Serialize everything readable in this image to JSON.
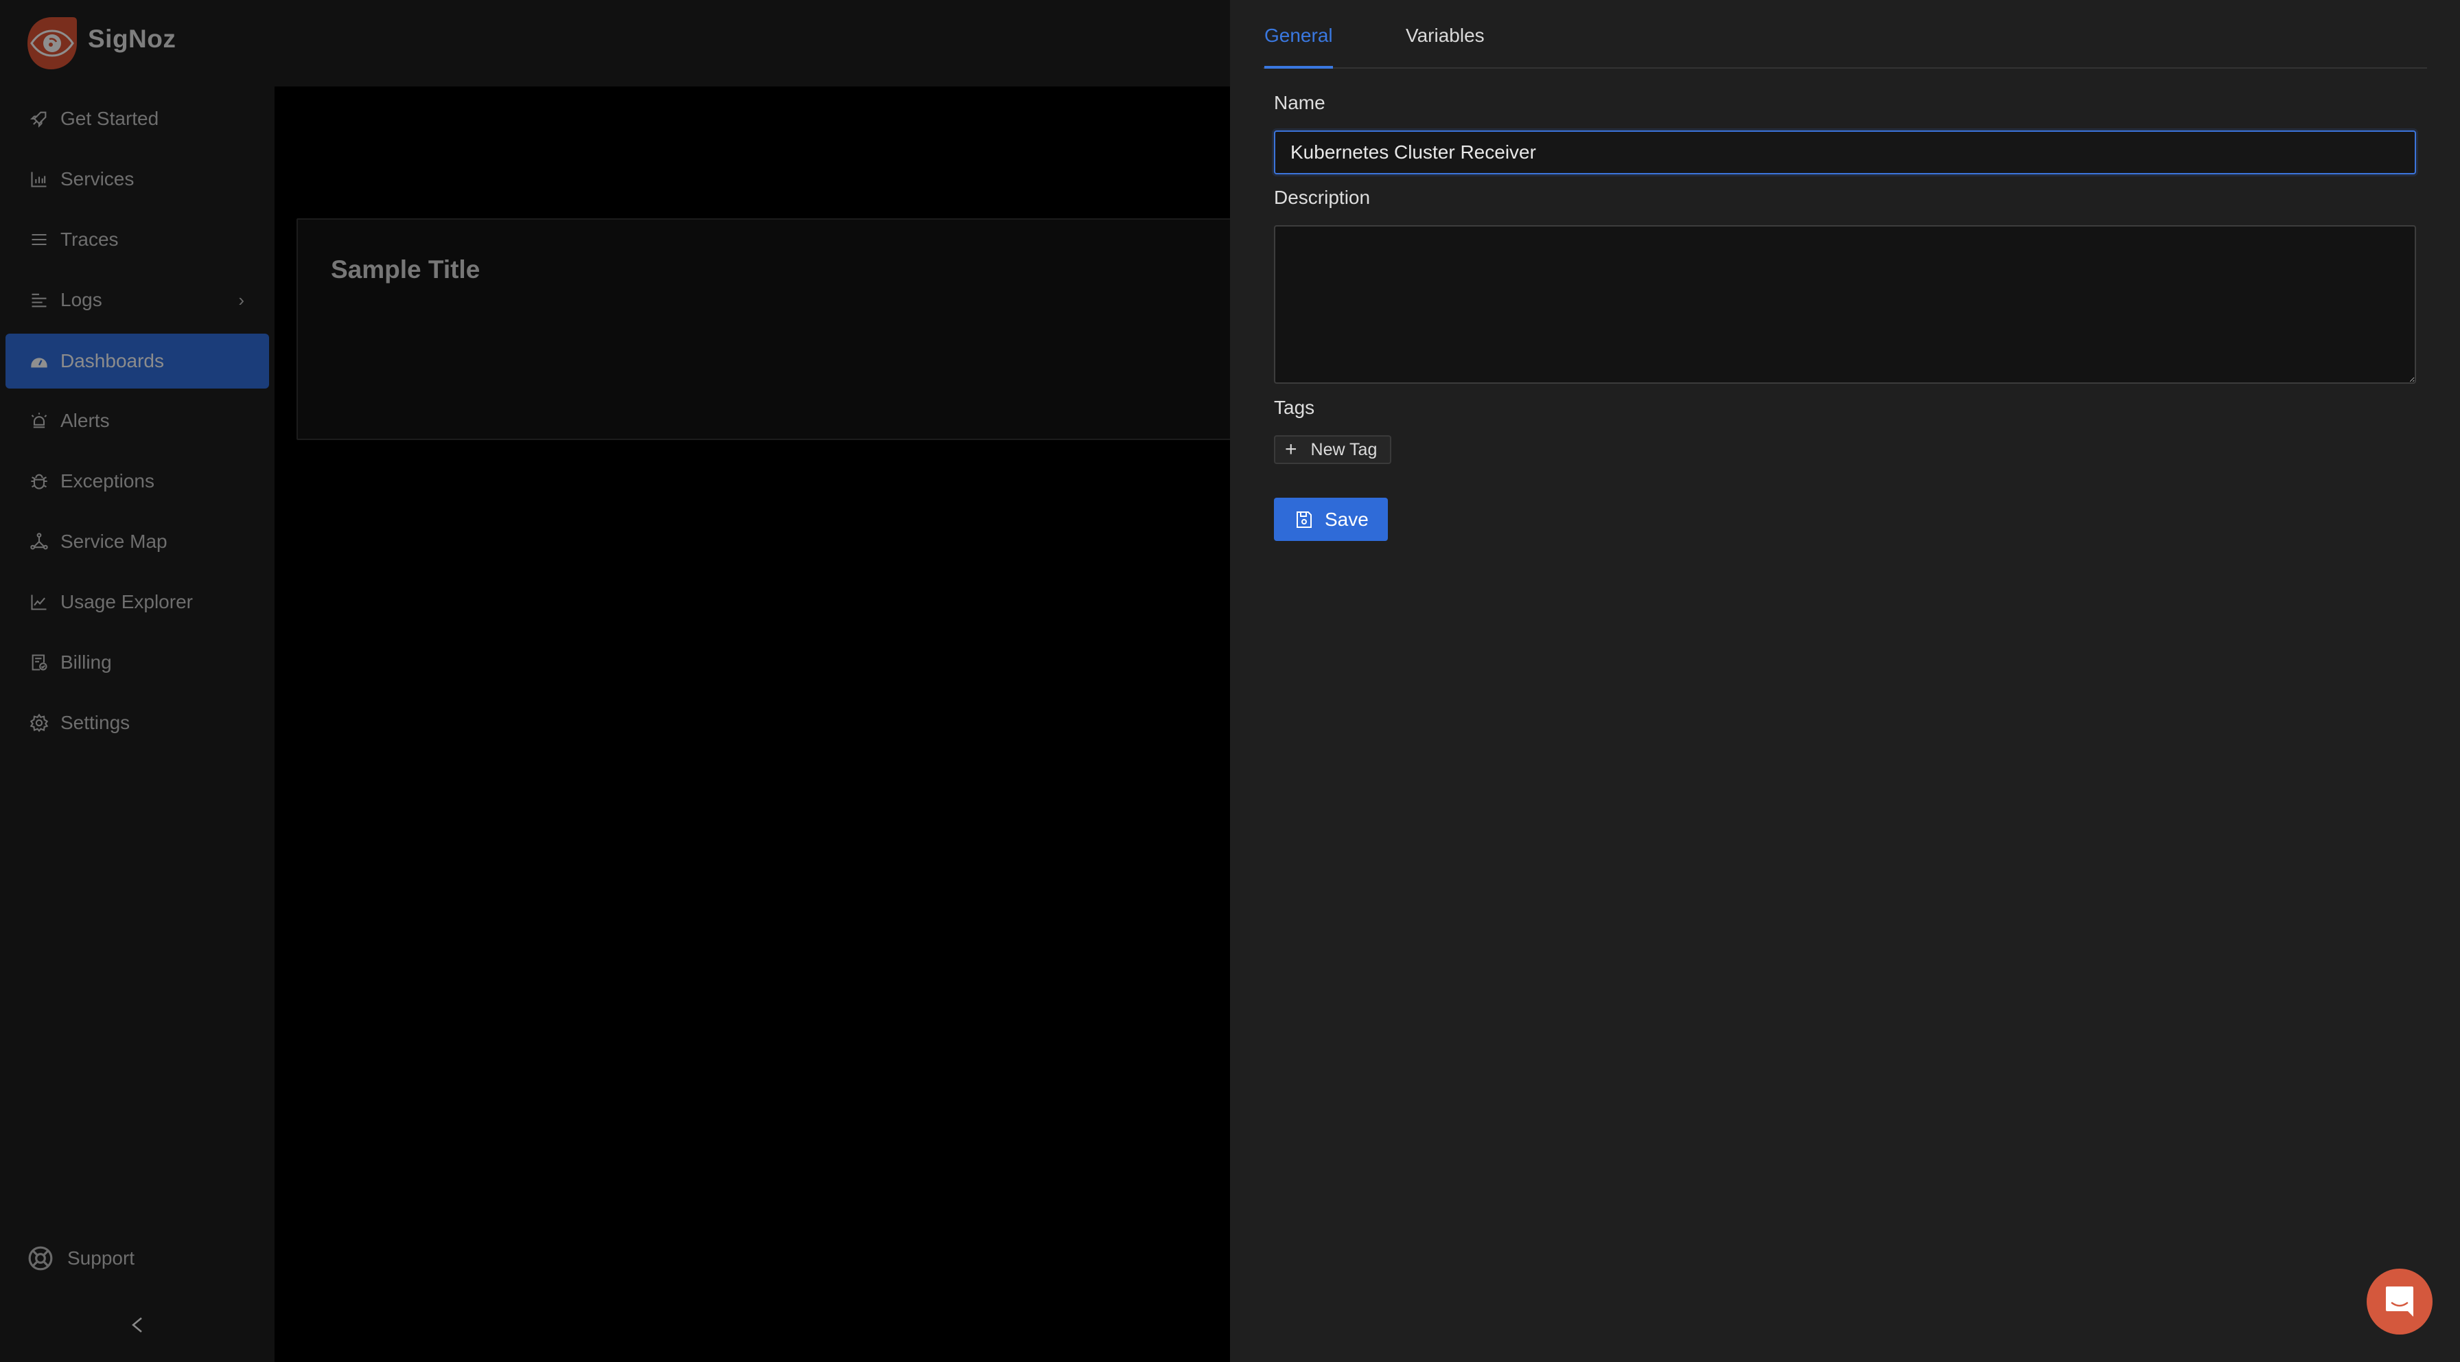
{
  "app": {
    "name": "SigNoz",
    "logo_icon": "signoz-eye-logo",
    "brand_color": "#c0462a"
  },
  "sidebar": {
    "items": [
      {
        "label": "Get Started",
        "icon": "rocket-icon",
        "active": false
      },
      {
        "label": "Services",
        "icon": "bar-chart-icon",
        "active": false
      },
      {
        "label": "Traces",
        "icon": "menu-lines-icon",
        "active": false
      },
      {
        "label": "Logs",
        "icon": "align-left-icon",
        "active": false,
        "has_submenu": true
      },
      {
        "label": "Dashboards",
        "icon": "dashboard-gauge-icon",
        "active": true
      },
      {
        "label": "Alerts",
        "icon": "alarm-siren-icon",
        "active": false
      },
      {
        "label": "Exceptions",
        "icon": "bug-icon",
        "active": false
      },
      {
        "label": "Service Map",
        "icon": "network-icon",
        "active": false
      },
      {
        "label": "Usage Explorer",
        "icon": "line-chart-icon",
        "active": false
      },
      {
        "label": "Billing",
        "icon": "receipt-check-icon",
        "active": false
      },
      {
        "label": "Settings",
        "icon": "gear-icon",
        "active": false
      }
    ],
    "support_label": "Support",
    "collapse_icon": "chevron-left-icon",
    "active_color": "#1b3d7a"
  },
  "main": {
    "panel_title": "Sample Title"
  },
  "drawer": {
    "tabs": [
      {
        "label": "General",
        "active": true
      },
      {
        "label": "Variables",
        "active": false
      }
    ],
    "name_label": "Name",
    "name_value": "Kubernetes Cluster Receiver",
    "description_label": "Description",
    "description_value": "",
    "tags_label": "Tags",
    "new_tag_label": "New Tag",
    "save_label": "Save",
    "accent_color": "#2f6bd8"
  },
  "chat": {
    "icon": "chat-smile-icon",
    "color": "#d4583d"
  }
}
